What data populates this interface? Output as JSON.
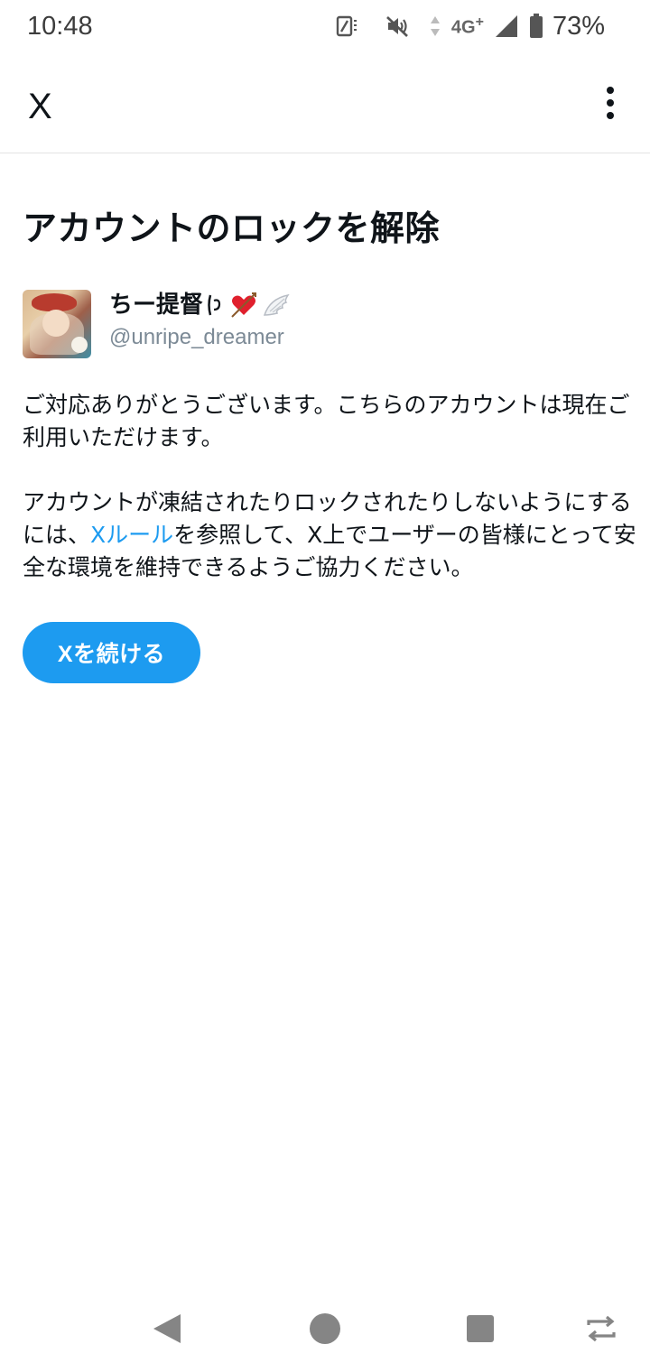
{
  "status_bar": {
    "time": "10:48",
    "network": "4G",
    "network_plus": "+",
    "battery": "73%",
    "icons": [
      "nfc-icon",
      "mute-icon",
      "data-arrows-icon",
      "signal-icon",
      "battery-icon"
    ]
  },
  "app_bar": {
    "title": "X",
    "menu_icon": "more-vertical-icon"
  },
  "page": {
    "title": "アカウントのロックを解除"
  },
  "account": {
    "display_name": "ちー提督ʚ💘🪽",
    "display_name_text": "ちー提督",
    "username": "@unripe_dreamer"
  },
  "message": {
    "paragraph1": "ご対応ありがとうございます。こちらのアカウントは現在ご利用いただけます。",
    "paragraph2_before": "アカウントが凍結されたりロックされたりしないようにするには、",
    "paragraph2_link": "Xルール",
    "paragraph2_after": "を参照して、X上でユーザーの皆様にとって安全な環境を維持できるようご協力ください。"
  },
  "actions": {
    "continue_label": "Xを続ける"
  },
  "colors": {
    "accent": "#1d9bf0",
    "text": "#0f1419",
    "secondary_text": "#7c8a96",
    "divider": "#e3e3e3"
  },
  "nav_bar": {
    "icons": [
      "back-icon",
      "home-icon",
      "recents-icon",
      "rotate-icon"
    ]
  }
}
